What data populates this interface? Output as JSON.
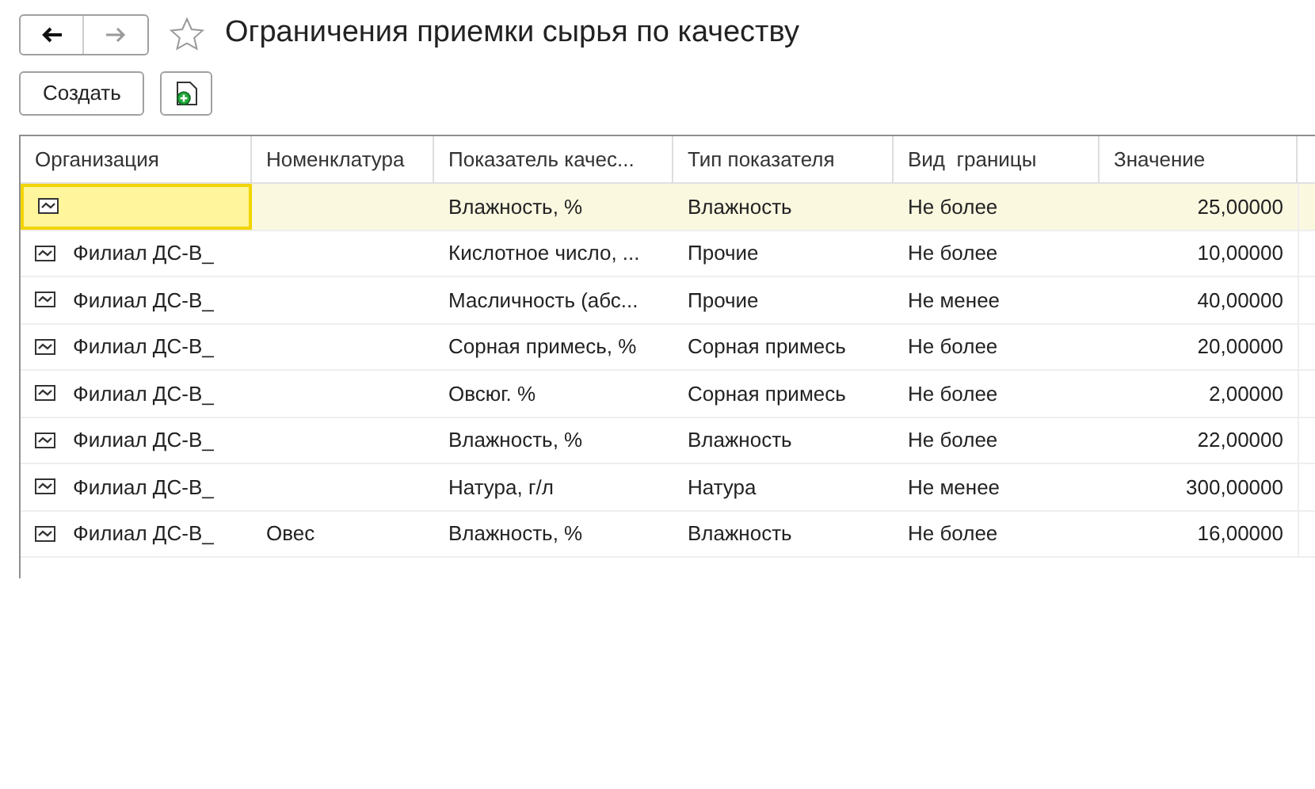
{
  "window": {
    "title": "Ограничения приемки сырья по качеству",
    "favorite": false
  },
  "toolbar": {
    "create_button": "Создать"
  },
  "table": {
    "columns": [
      "Организация",
      "Номенклатура",
      "Показатель качес...",
      "Тип показателя",
      "Вид  границы",
      "Значение"
    ],
    "rows": [
      {
        "selected": true,
        "organization": "",
        "nomenclature": "",
        "indicator": "Влажность, %",
        "type": "Влажность",
        "limit": "Не более",
        "value": "25,00000"
      },
      {
        "selected": false,
        "organization": "Филиал ДС-В_",
        "nomenclature": "",
        "indicator": "Кислотное число, ...",
        "type": "Прочие",
        "limit": "Не более",
        "value": "10,00000"
      },
      {
        "selected": false,
        "organization": "Филиал ДС-В_",
        "nomenclature": "",
        "indicator": "Масличность (абс...",
        "type": "Прочие",
        "limit": "Не менее",
        "value": "40,00000"
      },
      {
        "selected": false,
        "organization": "Филиал ДС-В_",
        "nomenclature": "",
        "indicator": "Сорная примесь, %",
        "type": "Сорная примесь",
        "limit": "Не более",
        "value": "20,00000"
      },
      {
        "selected": false,
        "organization": "Филиал ДС-В_",
        "nomenclature": "",
        "indicator": "Овсюг. %",
        "type": "Сорная примесь",
        "limit": "Не более",
        "value": "2,00000"
      },
      {
        "selected": false,
        "organization": "Филиал ДС-В_",
        "nomenclature": "",
        "indicator": "Влажность, %",
        "type": "Влажность",
        "limit": "Не более",
        "value": "22,00000"
      },
      {
        "selected": false,
        "organization": "Филиал ДС-В_",
        "nomenclature": "",
        "indicator": "Натура, г/л",
        "type": "Натура",
        "limit": "Не менее",
        "value": "300,00000"
      },
      {
        "selected": false,
        "organization": "Филиал ДС-В_",
        "nomenclature": "Овес",
        "indicator": "Влажность, %",
        "type": "Влажность",
        "limit": "Не более",
        "value": "16,00000"
      }
    ]
  }
}
